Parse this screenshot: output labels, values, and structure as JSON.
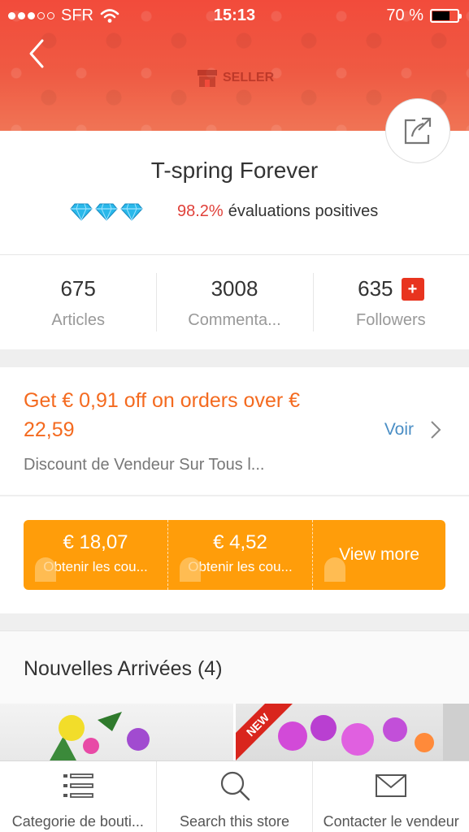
{
  "status_bar": {
    "carrier": "SFR",
    "time": "15:13",
    "battery": "70 %",
    "battery_level": 0.7
  },
  "header": {
    "seller_badge": "SELLER"
  },
  "store": {
    "name": "T-spring Forever",
    "rating_percent": "98.2%",
    "rating_label": "évaluations positives",
    "diamond_count": 3
  },
  "stats": [
    {
      "value": "675",
      "label": "Articles"
    },
    {
      "value": "3008",
      "label": "Commenta..."
    },
    {
      "value": "635",
      "label": "Followers",
      "badge": "+"
    }
  ],
  "promo": {
    "title": "Get € 0,91 off on orders over € 22,59",
    "link": "Voir",
    "description": "Discount de Vendeur Sur Tous l..."
  },
  "coupons": [
    {
      "amount": "€ 18,07",
      "action": "Obtenir les cou..."
    },
    {
      "amount": "€ 4,52",
      "action": "Obtenir les cou..."
    }
  ],
  "coupons_more": "View more",
  "new_arrivals": {
    "title": "Nouvelles Arrivées (4)",
    "ribbon": "NEW"
  },
  "bottom_nav": [
    {
      "label": "Categorie de bouti...",
      "icon": "list-icon"
    },
    {
      "label": "Search this store",
      "icon": "search-icon"
    },
    {
      "label": "Contacter le vendeur",
      "icon": "mail-icon"
    }
  ],
  "colors": {
    "accent": "#f46a1f",
    "banner": "#f24b3b",
    "coupon": "#ff9d0a",
    "link": "#4a8ec5",
    "rating": "#e0413a"
  }
}
